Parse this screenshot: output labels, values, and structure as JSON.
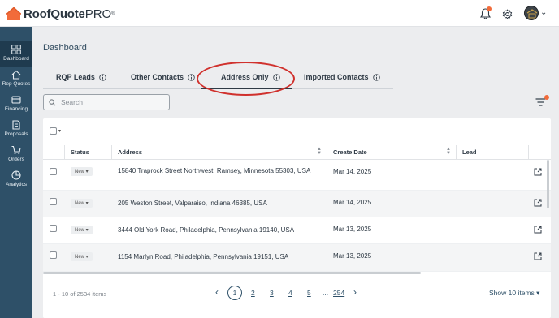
{
  "app": {
    "brand_main": "RoofQuote",
    "brand_pro": "PRO",
    "brand_reg": "®"
  },
  "colors": {
    "sidebar": "#2e5068",
    "sidebar_active": "#1f3b4f",
    "accent": "#f26b3a",
    "annotation": "#d0312d"
  },
  "sidebar": {
    "items": [
      {
        "label": "Dashboard",
        "icon": "dashboard-icon"
      },
      {
        "label": "Rep Quotes",
        "icon": "house-icon"
      },
      {
        "label": "Financing",
        "icon": "financing-icon"
      },
      {
        "label": "Proposals",
        "icon": "document-icon"
      },
      {
        "label": "Orders",
        "icon": "cart-icon"
      },
      {
        "label": "Analytics",
        "icon": "analytics-icon"
      }
    ]
  },
  "page": {
    "title": "Dashboard"
  },
  "tabs": [
    {
      "label": "RQP Leads"
    },
    {
      "label": "Other Contacts"
    },
    {
      "label": "Address Only",
      "active": true
    },
    {
      "label": "Imported Contacts"
    }
  ],
  "search": {
    "placeholder": "Search",
    "value": ""
  },
  "table": {
    "columns": [
      "Status",
      "Address",
      "Create Date",
      "Lead"
    ],
    "rows": [
      {
        "status": "New",
        "address": "15840 Traprock Street Northwest, Ramsey, Minnesota 55303, USA",
        "create_date": "Mar 14, 2025"
      },
      {
        "status": "New",
        "address": "205 Weston Street, Valparaiso, Indiana 46385, USA",
        "create_date": "Mar 14, 2025"
      },
      {
        "status": "New",
        "address": "3444 Old York Road, Philadelphia, Pennsylvania 19140, USA",
        "create_date": "Mar 13, 2025"
      },
      {
        "status": "New",
        "address": "1154 Marlyn Road, Philadelphia, Pennsylvania 19151, USA",
        "create_date": "Mar 13, 2025"
      }
    ]
  },
  "pagination": {
    "info": "1 - 10 of 2534 items",
    "pages": [
      "1",
      "2",
      "3",
      "4",
      "5",
      "...",
      "254"
    ],
    "current": "1",
    "prev": "‹",
    "next": "›",
    "show_label": "Show 10 items"
  }
}
